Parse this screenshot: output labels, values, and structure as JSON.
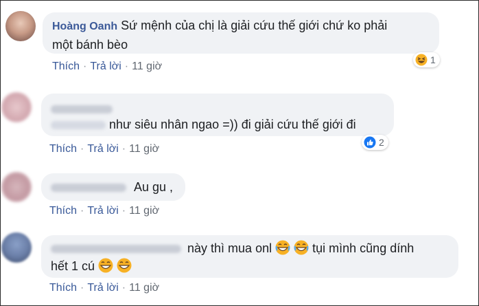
{
  "comments": [
    {
      "name": "Hoàng Oanh",
      "line1": "Sứ mệnh của chị là giải cứu thế giới chứ ko phải",
      "line2": "một bánh bèo",
      "reaction": {
        "icon": "haha-laugh-icon",
        "count": "1"
      },
      "actions": {
        "like": "Thích",
        "reply": "Trả lời",
        "time": "11 giờ"
      }
    },
    {
      "text": "như siêu nhân ngao =)) đi giải cứu thế giới đi",
      "reaction": {
        "icon": "like-thumb-icon",
        "count": "2"
      },
      "actions": {
        "like": "Thích",
        "reply": "Trả lời",
        "time": "11 giờ"
      }
    },
    {
      "text": "Au gu ,",
      "actions": {
        "like": "Thích",
        "reply": "Trả lời",
        "time": "11 giờ"
      }
    },
    {
      "line1a": "này thì mua onl",
      "line1b": "tụi mình cũng dính",
      "line2": "hết 1 cú",
      "actions": {
        "like": "Thích",
        "reply": "Trả lời",
        "time": "11 giờ"
      }
    }
  ],
  "colors": {
    "bubble": "#f0f2f5",
    "link": "#385898",
    "like_blue": "#1877f2"
  }
}
